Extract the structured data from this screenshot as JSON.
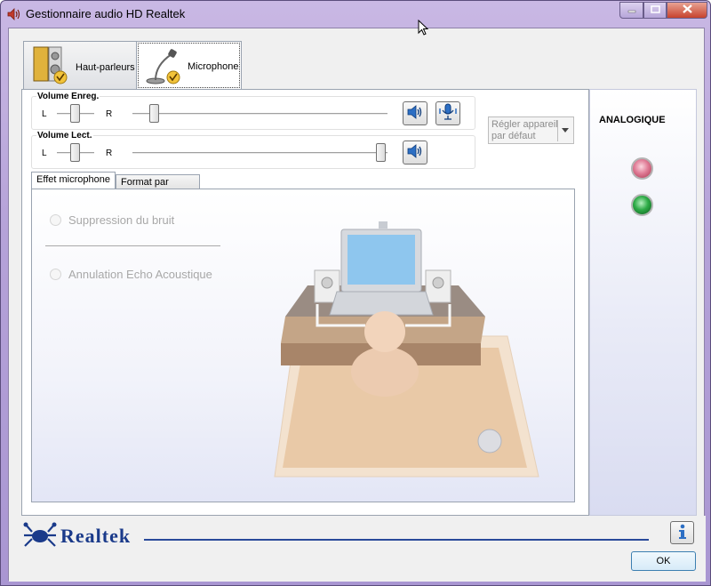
{
  "window": {
    "title": "Gestionnaire audio HD Realtek",
    "min_icon": "minimize-icon",
    "max_icon": "maximize-icon",
    "close_icon": "close-icon"
  },
  "device_tabs": [
    {
      "label": "Haut-parleurs",
      "icon": "speakers-icon",
      "active": false
    },
    {
      "label": "Microphone",
      "icon": "microphone-icon",
      "active": true
    }
  ],
  "volume_record": {
    "label": "Volume Enreg.",
    "left_label": "L",
    "right_label": "R",
    "balance": 0.5,
    "level": 0.08,
    "mute_icon": "speaker-icon",
    "boost_icon": "microphone-boost-icon"
  },
  "volume_playback": {
    "label": "Volume Lect.",
    "left_label": "L",
    "right_label": "R",
    "balance": 0.5,
    "level": 1.0,
    "mute_icon": "speaker-icon"
  },
  "default_device": {
    "line1": "Régler appareil",
    "line2": "par défaut"
  },
  "sub_tabs": [
    {
      "label": "Effet microphone",
      "active": true
    },
    {
      "label": "Format par défaut",
      "active": false
    }
  ],
  "effects": {
    "noise_suppression": "Suppression du bruit",
    "echo_cancellation": "Annulation Echo Acoustique"
  },
  "jacks": {
    "label": "ANALOGIQUE",
    "colors": {
      "pink": "#e07c96",
      "green": "#2eab47"
    }
  },
  "footer": {
    "brand": "Realtek",
    "info_icon": "info-icon",
    "ok_label": "OK"
  },
  "colors": {
    "title_bar": "#b5a2d8",
    "brand_blue": "#1a3a8a",
    "close_red": "#c7432e"
  }
}
